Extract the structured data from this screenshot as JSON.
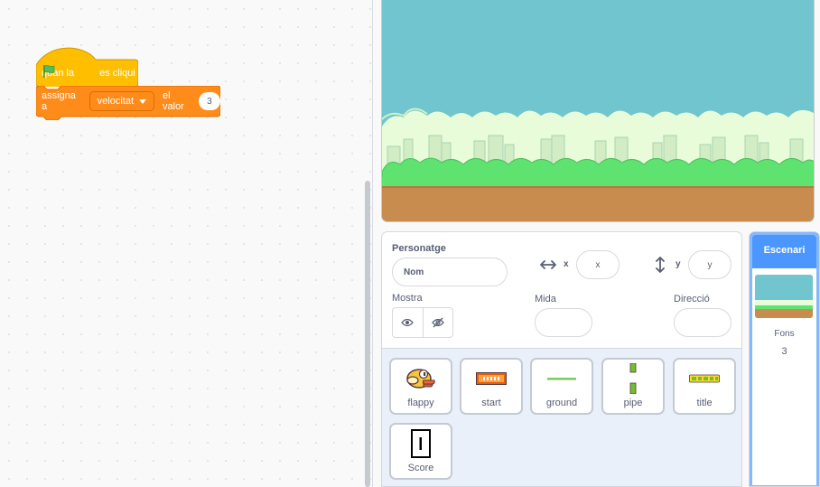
{
  "code": {
    "hat_block": {
      "text_before": "quan la",
      "icon": "green-flag-icon",
      "text_after": "es cliqui"
    },
    "set_block": {
      "text": "assigna a",
      "variable": "velocitat",
      "mid_text": "el valor",
      "value": "3"
    }
  },
  "sprite_info": {
    "sprite_label": "Personatge",
    "name_placeholder": "Nom",
    "x_label": "x",
    "x_placeholder": "x",
    "y_label": "y",
    "y_placeholder": "y",
    "show_label": "Mostra",
    "size_label": "Mida",
    "direction_label": "Direcció"
  },
  "sprites": [
    {
      "name": "flappy",
      "icon": "bird-icon"
    },
    {
      "name": "start",
      "icon": "start-banner-icon"
    },
    {
      "name": "ground",
      "icon": "ground-line-icon"
    },
    {
      "name": "pipe",
      "icon": "pipe-icon"
    },
    {
      "name": "title",
      "icon": "title-logo-icon"
    },
    {
      "name": "Score",
      "icon": "score-icon"
    }
  ],
  "stage_selector": {
    "label": "Escenari",
    "backdrops_label": "Fons",
    "backdrops_count": "3"
  },
  "colors": {
    "events_yellow": "#ffbf00",
    "variables_orange": "#ff8c1a",
    "accent_blue": "#4c97ff",
    "sky": "#70c5ce",
    "ground": "#ded895"
  }
}
